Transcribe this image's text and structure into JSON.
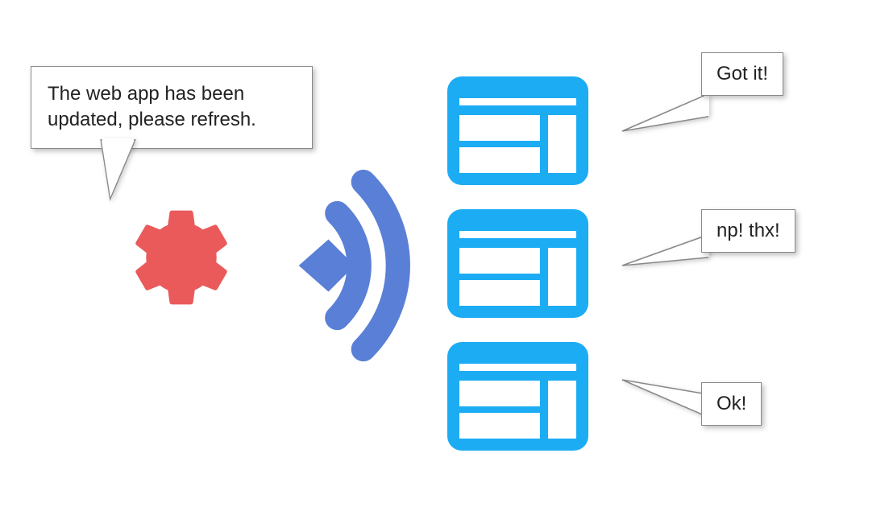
{
  "main_bubble": {
    "text": "The web app has been updated, please refresh."
  },
  "replies": [
    {
      "text": "Got it!"
    },
    {
      "text": "np! thx!"
    },
    {
      "text": "Ok!"
    }
  ],
  "icons": {
    "gear": "gear-icon",
    "broadcast": "broadcast-icon",
    "app_window": "app-window-icon"
  },
  "colors": {
    "gear": "#EA5A5A",
    "broadcast": "#5A7FD6",
    "window": "#1CACF4"
  }
}
